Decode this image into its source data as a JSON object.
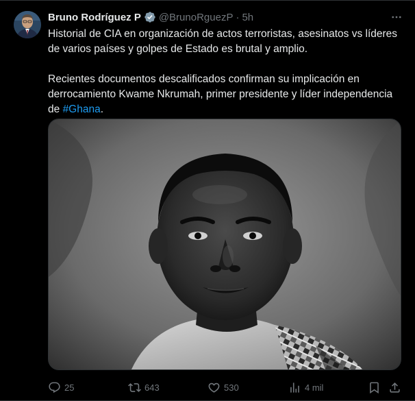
{
  "tweet": {
    "author": {
      "display_name": "Bruno Rodríguez P",
      "handle": "@BrunoRguezP",
      "verified": true,
      "avatar": "avatar-portrait"
    },
    "separator": "·",
    "time": "5h",
    "text": {
      "paragraph1": "Historial de CIA en organización de actos terroristas, asesinatos vs líderes de varios países y golpes de Estado es brutal y amplio.",
      "paragraph2_prefix": "Recientes documentos descalificados confirman su implicación en derrocamiento Kwame Nkrumah, primer presidente y líder independencia de ",
      "hashtag": "#Ghana",
      "paragraph2_suffix": "."
    },
    "media": {
      "type": "photo",
      "description_icon": "black-and-white-portrait-photo"
    },
    "actions": {
      "reply": {
        "icon": "reply-icon",
        "count": "25"
      },
      "retweet": {
        "icon": "retweet-icon",
        "count": "643"
      },
      "like": {
        "icon": "heart-icon",
        "count": "530"
      },
      "views": {
        "icon": "views-icon",
        "count": "4 mil"
      },
      "bookmark": {
        "icon": "bookmark-icon"
      },
      "share": {
        "icon": "share-icon"
      }
    }
  },
  "colors": {
    "background": "#000000",
    "text": "#e7e9ea",
    "secondary": "#71767b",
    "link": "#1d9bf0",
    "verified": "#829aab",
    "border": "#2f3336"
  }
}
